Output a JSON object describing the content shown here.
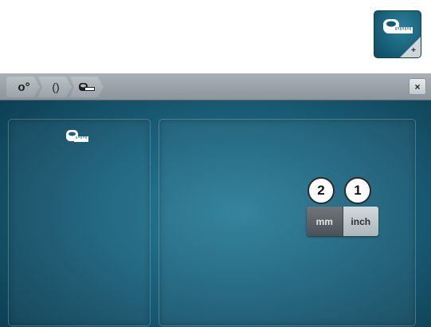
{
  "top_icon": {
    "icon": "tape-measure-plus-icon",
    "corner_label": "+"
  },
  "titlebar": {
    "breadcrumbs": [
      {
        "glyph": "o°",
        "icon": "setup-icon"
      },
      {
        "glyph": "()",
        "icon": "hoop-icon"
      },
      {
        "glyph": "",
        "icon": "tape-measure-icon"
      }
    ],
    "close_label": "×"
  },
  "units": {
    "options": [
      "mm",
      "inch"
    ],
    "selected": "mm"
  },
  "callouts": [
    "2",
    "1"
  ],
  "colors": {
    "background_center": "#2b7e99",
    "background_edge": "#0b3a4e",
    "titlebar": "#9aa4a9",
    "selected_segment": "#4b5257",
    "unselected_segment": "#c3cacd"
  }
}
